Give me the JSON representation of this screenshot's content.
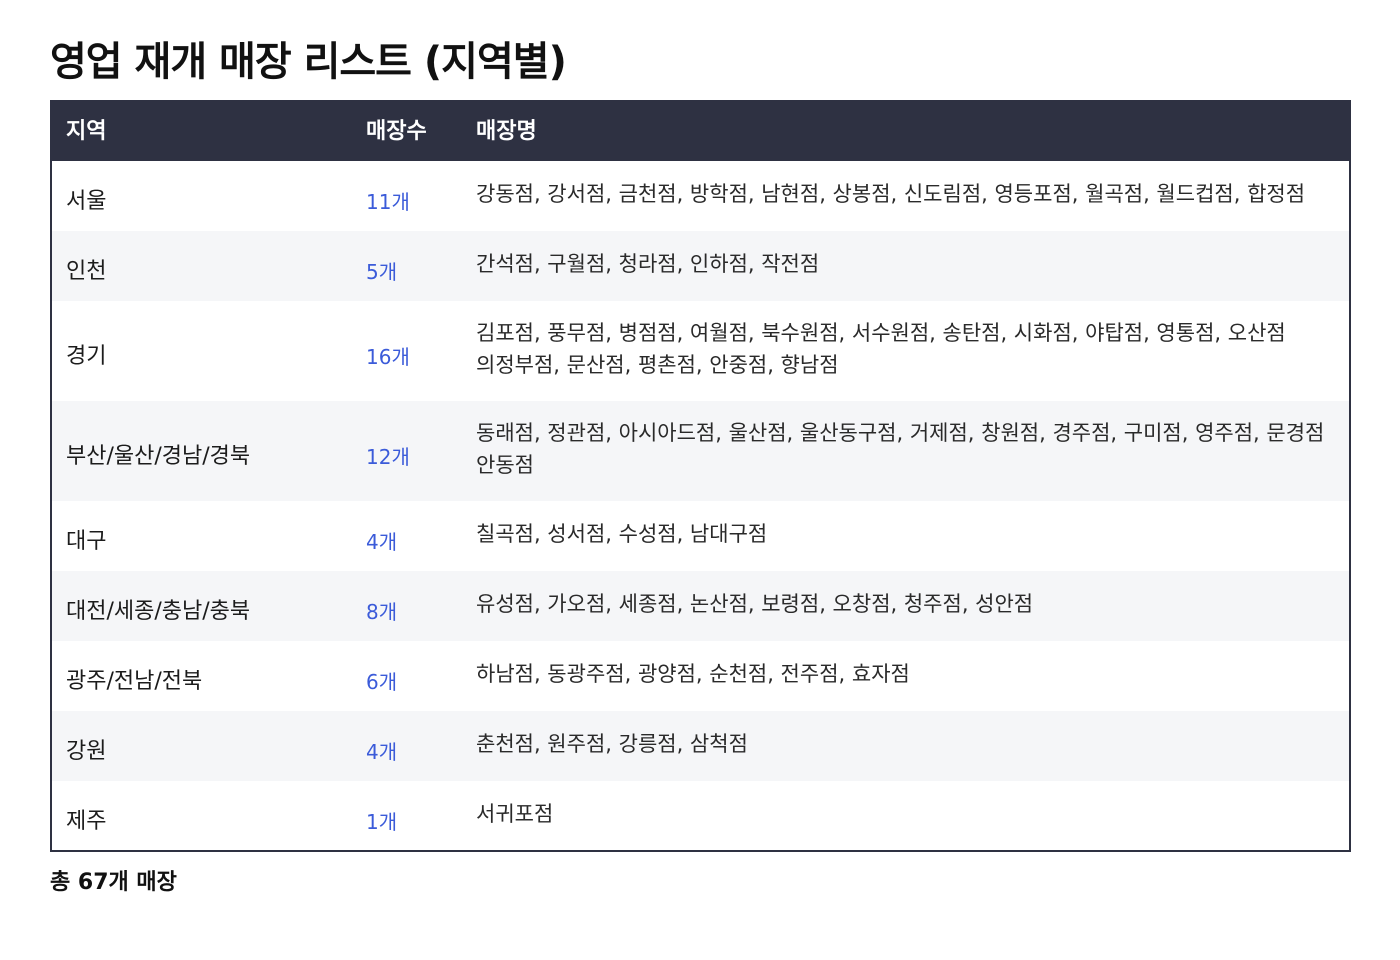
{
  "title": "영업 재개 매장 리스트 (지역별)",
  "table": {
    "headers": {
      "region": "지역",
      "count": "매장수",
      "stores": "매장명"
    },
    "rows": [
      {
        "region": "서울",
        "count": "11개",
        "stores_lines": [
          "강동점, 강서점, 금천점, 방학점, 남현점, 상봉점, 신도림점, 영등포점, 월곡점, 월드컵점, 합정점"
        ]
      },
      {
        "region": "인천",
        "count": "5개",
        "stores_lines": [
          "간석점, 구월점, 청라점, 인하점, 작전점"
        ]
      },
      {
        "region": "경기",
        "count": "16개",
        "stores_lines": [
          "김포점, 풍무점, 병점점, 여월점, 북수원점, 서수원점, 송탄점, 시화점, 야탑점, 영통점, 오산점",
          "의정부점, 문산점, 평촌점, 안중점, 향남점"
        ]
      },
      {
        "region": "부산/울산/경남/경북",
        "count": "12개",
        "stores_lines": [
          "동래점, 정관점, 아시아드점, 울산점, 울산동구점, 거제점, 창원점, 경주점, 구미점, 영주점, 문경점",
          "안동점"
        ]
      },
      {
        "region": "대구",
        "count": "4개",
        "stores_lines": [
          "칠곡점, 성서점, 수성점, 남대구점"
        ]
      },
      {
        "region": "대전/세종/충남/충북",
        "count": "8개",
        "stores_lines": [
          "유성점, 가오점, 세종점, 논산점, 보령점, 오창점, 청주점, 성안점"
        ]
      },
      {
        "region": "광주/전남/전북",
        "count": "6개",
        "stores_lines": [
          "하남점, 동광주점, 광양점, 순천점, 전주점, 효자점"
        ]
      },
      {
        "region": "강원",
        "count": "4개",
        "stores_lines": [
          "춘천점, 원주점, 강릉점, 삼척점"
        ]
      },
      {
        "region": "제주",
        "count": "1개",
        "stores_lines": [
          "서귀포점"
        ]
      }
    ]
  },
  "total": "총 67개 매장",
  "colors": {
    "header_bg": "#2e3142",
    "header_text": "#ffffff",
    "count_text": "#3b5bd9",
    "alt_row_bg": "#f5f6f8"
  }
}
